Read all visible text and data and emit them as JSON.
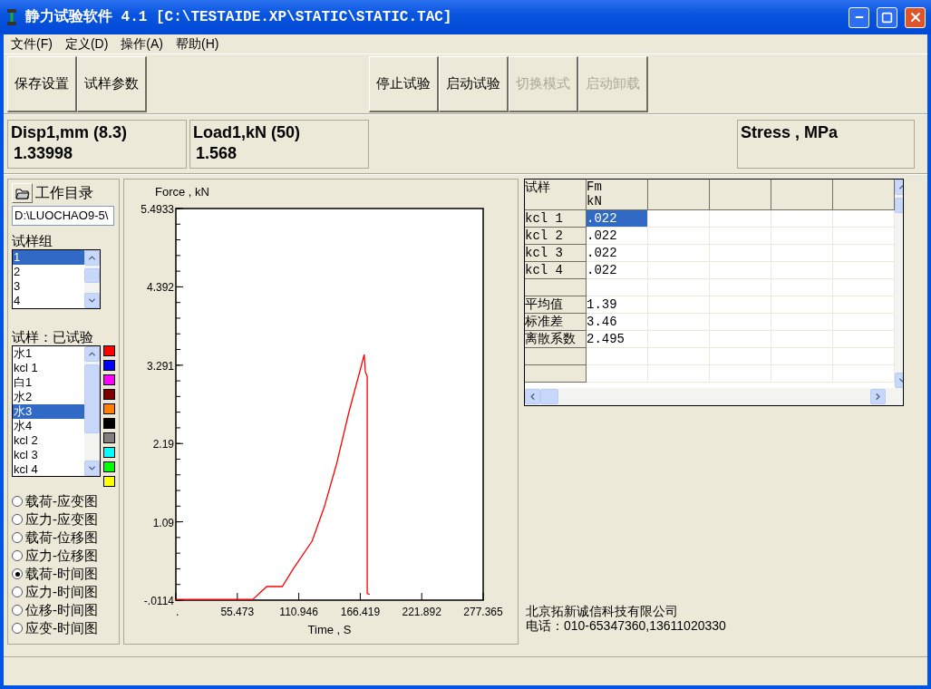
{
  "window": {
    "title": "静力试验软件 4.1 [C:\\TESTAIDE.XP\\STATIC\\STATIC.TAC]"
  },
  "menu": [
    {
      "label": "文件(F)"
    },
    {
      "label": "定义(D)"
    },
    {
      "label": "操作(A)"
    },
    {
      "label": "帮助(H)"
    }
  ],
  "toolbar_left": [
    {
      "label": "保存设置",
      "disabled": false
    },
    {
      "label": "试样参数",
      "disabled": false
    }
  ],
  "toolbar_right": [
    {
      "label": "停止试验",
      "disabled": false
    },
    {
      "label": "启动试验",
      "disabled": false
    },
    {
      "label": "切换模式",
      "disabled": true
    },
    {
      "label": "启动卸载",
      "disabled": true
    }
  ],
  "readouts": [
    {
      "label": "Disp1,mm (8.3)",
      "value": "1.33998"
    },
    {
      "label": "Load1,kN (50)",
      "value": "1.568"
    }
  ],
  "right_readout": {
    "label": "Stress , MPa"
  },
  "work_dir": {
    "label": "工作目录",
    "value": "D:\\LUOCHAO9-5\\"
  },
  "specimen_groups": {
    "label": "试样组",
    "items": [
      {
        "label": "1",
        "selected": true
      },
      {
        "label": "2",
        "selected": false
      },
      {
        "label": "3",
        "selected": false
      },
      {
        "label": "4",
        "selected": false
      }
    ]
  },
  "specimens": {
    "label": "试样：已试验",
    "items": [
      {
        "label": "水1",
        "selected": false
      },
      {
        "label": "kcl 1",
        "selected": false
      },
      {
        "label": "白1",
        "selected": false
      },
      {
        "label": "水2",
        "selected": false
      },
      {
        "label": "水3",
        "selected": true
      },
      {
        "label": "水4",
        "selected": false
      },
      {
        "label": "kcl 2",
        "selected": false
      },
      {
        "label": "kcl 3",
        "selected": false
      },
      {
        "label": "kcl 4",
        "selected": false
      }
    ],
    "colors": [
      {
        "color": "#ff0000"
      },
      {
        "color": "#0000ff"
      },
      {
        "color": "#ff00ff"
      },
      {
        "color": "#800000"
      },
      {
        "color": "#ff8000"
      },
      {
        "color": "#000000"
      },
      {
        "color": "#808080"
      },
      {
        "color": "#00ffff"
      },
      {
        "color": "#00ff00"
      },
      {
        "color": "#ffff00"
      }
    ]
  },
  "chart_types": [
    {
      "label": "载荷-应变图",
      "selected": false
    },
    {
      "label": "应力-应变图",
      "selected": false
    },
    {
      "label": "载荷-位移图",
      "selected": false
    },
    {
      "label": "应力-位移图",
      "selected": false
    },
    {
      "label": "载荷-时间图",
      "selected": true
    },
    {
      "label": "应力-时间图",
      "selected": false
    },
    {
      "label": "位移-时间图",
      "selected": false
    },
    {
      "label": "应变-时间图",
      "selected": false
    }
  ],
  "chart": {
    "chart_data": {
      "type": "line",
      "xlabel": "Time , S",
      "ylabel": "Force , kN",
      "x": [
        0,
        69.5,
        82,
        96,
        106,
        123,
        134,
        145,
        156,
        167,
        170,
        171,
        172.7,
        172.7,
        175
      ],
      "series": [
        {
          "color": "#ff0000",
          "values": [
            0,
            0,
            0.18,
            0.18,
            0.43,
            0.82,
            1.3,
            1.9,
            2.62,
            3.26,
            3.44,
            3.2,
            3.13,
            0.08,
            0.07
          ]
        }
      ],
      "xlim": [
        0,
        277.365
      ],
      "ylim": [
        -0.0114,
        5.4933
      ],
      "xticks": [
        {
          "value": 0,
          "label": "."
        },
        55.473,
        110.946,
        166.419,
        221.892,
        277.365
      ],
      "yticks": [
        {
          "value": -0.0114,
          "label": "-.0114"
        },
        1.09,
        2.19,
        3.291,
        4.392,
        5.4933
      ]
    }
  },
  "results_table": {
    "columns": [
      {
        "name": "试样"
      },
      {
        "name": "Fm",
        "unit": "kN"
      }
    ],
    "rows": [
      {
        "kind": "data",
        "label": "kcl 1",
        "value": ".022",
        "selected": true
      },
      {
        "kind": "data",
        "label": "kcl 2",
        "value": ".022",
        "selected": false
      },
      {
        "kind": "data",
        "label": "kcl 3",
        "value": ".022",
        "selected": false
      },
      {
        "kind": "data",
        "label": "kcl 4",
        "value": ".022",
        "selected": false
      },
      {
        "kind": "blank"
      },
      {
        "kind": "data",
        "label": "平均值",
        "value": "1.39",
        "selected": false
      },
      {
        "kind": "data",
        "label": "标准差",
        "value": "3.46",
        "selected": false
      },
      {
        "kind": "data",
        "label": "离散系数",
        "value": "2.495",
        "selected": false
      },
      {
        "kind": "blank"
      },
      {
        "kind": "blank"
      }
    ]
  },
  "company": {
    "name": "北京拓新诚信科技有限公司",
    "phone": "电话：010-65347360,13611020330"
  }
}
